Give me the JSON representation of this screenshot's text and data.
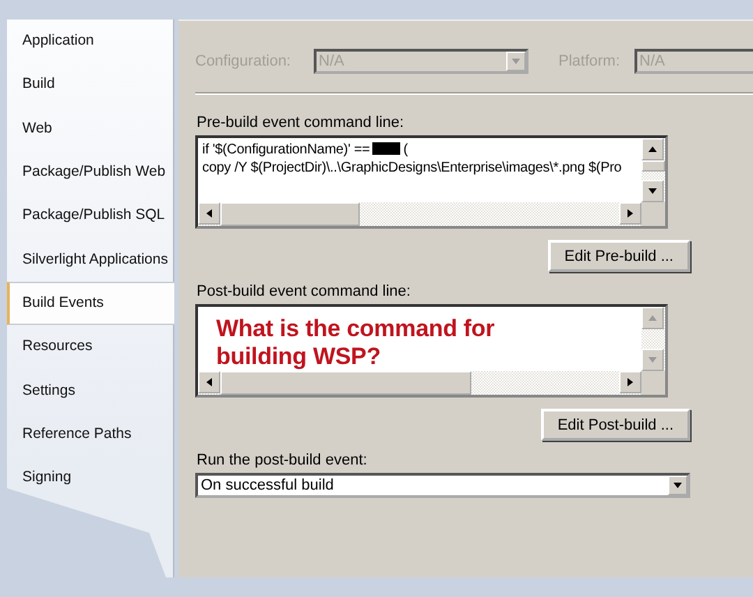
{
  "sidebar": {
    "items": [
      {
        "label": "Application",
        "selected": false
      },
      {
        "label": "Build",
        "selected": false
      },
      {
        "label": "Web",
        "selected": false
      },
      {
        "label": "Package/Publish Web",
        "selected": false
      },
      {
        "label": "Package/Publish SQL",
        "selected": false
      },
      {
        "label": "Silverlight Applications",
        "selected": false
      },
      {
        "label": "Build Events",
        "selected": true
      },
      {
        "label": "Resources",
        "selected": false
      },
      {
        "label": "Settings",
        "selected": false
      },
      {
        "label": "Reference Paths",
        "selected": false
      },
      {
        "label": "Signing",
        "selected": false
      }
    ]
  },
  "configuration": {
    "label": "Configuration:",
    "value": "N/A",
    "disabled": true
  },
  "platform": {
    "label": "Platform:",
    "value": "N/A",
    "disabled": true
  },
  "pre_build": {
    "label": "Pre-build event command line:",
    "lines": [
      {
        "before": "if '$(ConfigurationName)' ==",
        "redacted": true,
        "after": "("
      },
      {
        "before": "copy /Y $(ProjectDir)\\..\\GraphicDesigns\\Enterprise\\images\\*.png $(Pro",
        "redacted": false
      }
    ],
    "button": "Edit Pre-build ..."
  },
  "post_build": {
    "label": "Post-build event command line:",
    "overlay": "What is the command for building WSP?",
    "button": "Edit Post-build ..."
  },
  "run_post_build": {
    "label": "Run the post-build event:",
    "value": "On successful build"
  }
}
